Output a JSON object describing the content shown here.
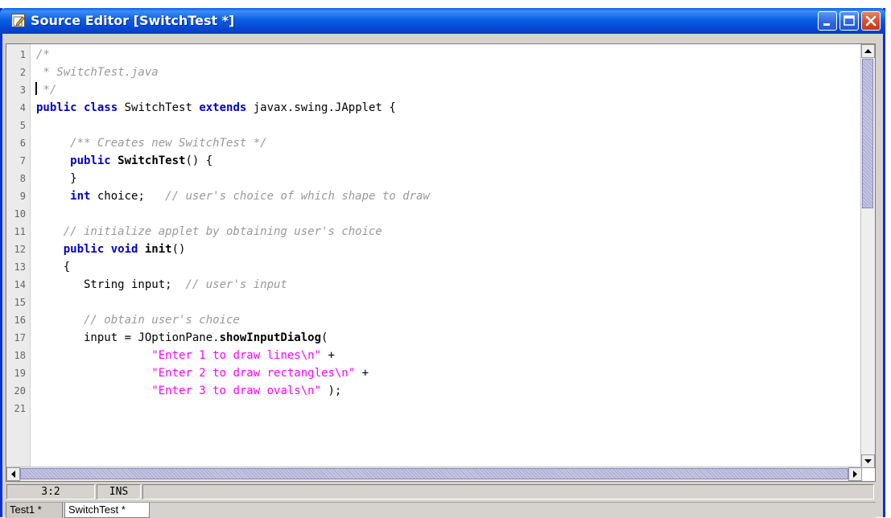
{
  "window": {
    "title": "Source Editor [SwitchTest *]"
  },
  "editor": {
    "lines": [
      {
        "num": "1",
        "tokens": [
          {
            "t": "/*",
            "c": "cm"
          }
        ]
      },
      {
        "num": "2",
        "tokens": [
          {
            "t": " * SwitchTest.java",
            "c": "cm"
          }
        ]
      },
      {
        "num": "3",
        "tokens": [
          {
            "t": " */",
            "c": "cm"
          }
        ]
      },
      {
        "num": "4",
        "tokens": [
          {
            "t": "public class",
            "c": "kw"
          },
          {
            "t": " SwitchTest ",
            "c": ""
          },
          {
            "t": "extends",
            "c": "kw"
          },
          {
            "t": " javax.swing.JApplet {",
            "c": ""
          }
        ]
      },
      {
        "num": "5",
        "tokens": []
      },
      {
        "num": "6",
        "tokens": [
          {
            "t": "     /** Creates new SwitchTest */",
            "c": "cm"
          }
        ]
      },
      {
        "num": "7",
        "tokens": [
          {
            "t": "     ",
            "c": ""
          },
          {
            "t": "public",
            "c": "kw"
          },
          {
            "t": " ",
            "c": ""
          },
          {
            "t": "SwitchTest",
            "c": "fn"
          },
          {
            "t": "() {",
            "c": ""
          }
        ]
      },
      {
        "num": "8",
        "tokens": [
          {
            "t": "     }",
            "c": ""
          }
        ]
      },
      {
        "num": "9",
        "tokens": [
          {
            "t": "     ",
            "c": ""
          },
          {
            "t": "int",
            "c": "kw"
          },
          {
            "t": " choice;   ",
            "c": ""
          },
          {
            "t": "// user's choice of which shape to draw",
            "c": "cm"
          }
        ]
      },
      {
        "num": "10",
        "tokens": []
      },
      {
        "num": "11",
        "tokens": [
          {
            "t": "    // initialize applet by obtaining user's choice",
            "c": "cm"
          }
        ]
      },
      {
        "num": "12",
        "tokens": [
          {
            "t": "    ",
            "c": ""
          },
          {
            "t": "public void",
            "c": "kw"
          },
          {
            "t": " ",
            "c": ""
          },
          {
            "t": "init",
            "c": "fn"
          },
          {
            "t": "()",
            "c": ""
          }
        ]
      },
      {
        "num": "13",
        "tokens": [
          {
            "t": "    {",
            "c": ""
          }
        ]
      },
      {
        "num": "14",
        "tokens": [
          {
            "t": "       String input;  ",
            "c": ""
          },
          {
            "t": "// user's input",
            "c": "cm"
          }
        ]
      },
      {
        "num": "15",
        "tokens": []
      },
      {
        "num": "16",
        "tokens": [
          {
            "t": "       // obtain user's choice",
            "c": "cm"
          }
        ]
      },
      {
        "num": "17",
        "tokens": [
          {
            "t": "       input = JOptionPane.",
            "c": ""
          },
          {
            "t": "showInputDialog",
            "c": "fn"
          },
          {
            "t": "(",
            "c": ""
          }
        ]
      },
      {
        "num": "18",
        "tokens": [
          {
            "t": "                 ",
            "c": ""
          },
          {
            "t": "\"Enter 1 to draw lines\\n\"",
            "c": "st"
          },
          {
            "t": " +",
            "c": ""
          }
        ]
      },
      {
        "num": "19",
        "tokens": [
          {
            "t": "                 ",
            "c": ""
          },
          {
            "t": "\"Enter 2 to draw rectangles\\n\"",
            "c": "st"
          },
          {
            "t": " +",
            "c": ""
          }
        ]
      },
      {
        "num": "20",
        "tokens": [
          {
            "t": "                 ",
            "c": ""
          },
          {
            "t": "\"Enter 3 to draw ovals\\n\"",
            "c": "st"
          },
          {
            "t": " );",
            "c": ""
          }
        ]
      },
      {
        "num": "21",
        "tokens": []
      }
    ]
  },
  "statusbar": {
    "cursor_position": "3:2",
    "insert_mode": "INS"
  },
  "tabs": [
    {
      "label": "Test1 *",
      "active": false
    },
    {
      "label": "SwitchTest *",
      "active": true
    }
  ],
  "colors": {
    "titlebar": "#0a5fe6",
    "keyword": "#0000cc",
    "comment": "#999999",
    "string": "#ff00ff"
  },
  "icons": {
    "title": "edit-document-icon",
    "minimize": "minimize-icon",
    "maximize": "maximize-icon",
    "close": "close-icon"
  }
}
